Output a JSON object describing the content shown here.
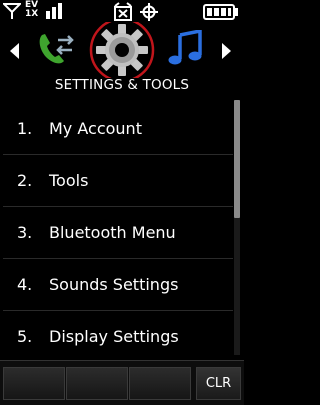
{
  "status_bar": {
    "network_top": "EV",
    "network_bottom": "1X",
    "icons": [
      "signal-antenna-icon",
      "signal-bars-icon",
      "alarm-icon",
      "gps-icon",
      "battery-icon"
    ],
    "battery_level": 1.0
  },
  "carousel": {
    "title": "SETTINGS & TOOLS",
    "icons": [
      "call-log-icon",
      "settings-gear-icon",
      "music-note-icon"
    ],
    "colors": {
      "gear_ring": "#c0151b",
      "phone": "#3fa52e",
      "music": "#2b6fe0"
    }
  },
  "menu": {
    "items": [
      {
        "num": "1.",
        "label": "My Account"
      },
      {
        "num": "2.",
        "label": "Tools"
      },
      {
        "num": "3.",
        "label": "Bluetooth Menu"
      },
      {
        "num": "4.",
        "label": "Sounds Settings"
      },
      {
        "num": "5.",
        "label": "Display Settings"
      }
    ]
  },
  "softkeys": {
    "clr_label": "CLR"
  }
}
